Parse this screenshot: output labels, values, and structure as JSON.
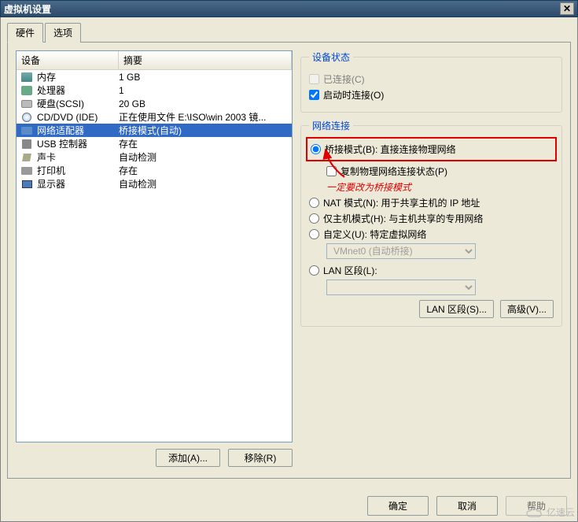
{
  "window": {
    "title": "虚拟机设置",
    "close": "✕"
  },
  "tabs": {
    "hardware": "硬件",
    "options": "选项"
  },
  "list": {
    "col_device": "设备",
    "col_summary": "摘要",
    "items": [
      {
        "icon": "memory-icon",
        "name": "内存",
        "summary": "1 GB"
      },
      {
        "icon": "cpu-icon",
        "name": "处理器",
        "summary": "1"
      },
      {
        "icon": "hdd-icon",
        "name": "硬盘(SCSI)",
        "summary": "20 GB"
      },
      {
        "icon": "cd-icon",
        "name": "CD/DVD (IDE)",
        "summary": "正在使用文件 E:\\ISO\\win 2003 镜..."
      },
      {
        "icon": "network-icon",
        "name": "网络适配器",
        "summary": "桥接模式(自动)"
      },
      {
        "icon": "usb-icon",
        "name": "USB 控制器",
        "summary": "存在"
      },
      {
        "icon": "sound-icon",
        "name": "声卡",
        "summary": "自动检测"
      },
      {
        "icon": "printer-icon",
        "name": "打印机",
        "summary": "存在"
      },
      {
        "icon": "monitor-icon",
        "name": "显示器",
        "summary": "自动检测"
      }
    ],
    "selected_index": 4,
    "add_btn": "添加(A)...",
    "remove_btn": "移除(R)"
  },
  "device_state": {
    "legend": "设备状态",
    "connected": "已连接(C)",
    "connected_checked": false,
    "connected_enabled": false,
    "connect_at_power": "启动时连接(O)",
    "connect_at_power_checked": true
  },
  "network": {
    "legend": "网络连接",
    "bridged": "桥接模式(B): 直接连接物理网络",
    "replicate": "复制物理网络连接状态(P)",
    "replicate_checked": false,
    "annotation": "一定要改为桥接模式",
    "nat": "NAT 模式(N): 用于共享主机的 IP 地址",
    "hostonly": "仅主机模式(H): 与主机共享的专用网络",
    "custom": "自定义(U): 特定虚拟网络",
    "custom_value": "VMnet0 (自动桥接)",
    "lanseg": "LAN 区段(L):",
    "lanseg_value": "",
    "selected": "bridged",
    "lanseg_btn": "LAN 区段(S)...",
    "advanced_btn": "高级(V)..."
  },
  "footer": {
    "ok": "确定",
    "cancel": "取消",
    "help": "帮助"
  },
  "watermark": "亿速云"
}
